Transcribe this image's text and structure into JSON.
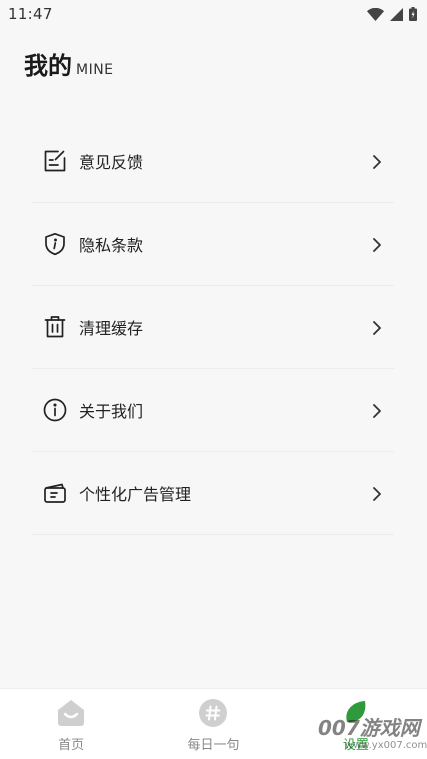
{
  "status_bar": {
    "time": "11:47",
    "icons": [
      "wifi-icon",
      "signal-icon",
      "battery-icon"
    ]
  },
  "header": {
    "title": "我的",
    "subtitle": "MINE"
  },
  "menu": {
    "items": [
      {
        "label": "意见反馈",
        "icon": "feedback-icon"
      },
      {
        "label": "隐私条款",
        "icon": "shield-info-icon"
      },
      {
        "label": "清理缓存",
        "icon": "trash-icon"
      },
      {
        "label": "关于我们",
        "icon": "info-circle-icon"
      },
      {
        "label": "个性化广告管理",
        "icon": "ad-card-icon"
      }
    ]
  },
  "bottom_nav": {
    "items": [
      {
        "label": "首页",
        "icon": "home-icon",
        "active": false
      },
      {
        "label": "每日一句",
        "icon": "hashtag-icon",
        "active": false
      },
      {
        "label": "设置",
        "icon": "leaf-icon",
        "active": true
      }
    ]
  },
  "watermark": {
    "text": "007游戏网",
    "url": "www.yx007.com"
  },
  "colors": {
    "background": "#f7f7f7",
    "accent_green": "#2e9a3c",
    "nav_inactive": "#c8c8c8"
  }
}
